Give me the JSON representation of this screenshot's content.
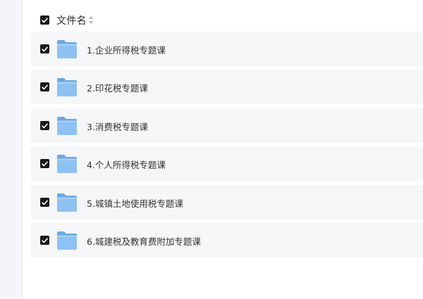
{
  "header": {
    "label": "文件名",
    "select_all_checked": true
  },
  "icons": {
    "checkbox": "checkbox-checked-icon",
    "sort": "sort-icon",
    "folder": "folder-icon"
  },
  "colors": {
    "checkbox": "#1a1a1a",
    "row_background": "#f5f6f8",
    "folder": "#8ec1f2",
    "sidebar": "#f3f5fb"
  },
  "files": [
    {
      "name": "1.企业所得税专题课",
      "checked": true
    },
    {
      "name": "2.印花税专题课",
      "checked": true
    },
    {
      "name": "3.消费税专题课",
      "checked": true
    },
    {
      "name": "4.个人所得税专题课",
      "checked": true
    },
    {
      "name": "5.城镇土地使用税专题课",
      "checked": true
    },
    {
      "name": "6.城建税及教育费附加专题课",
      "checked": true
    }
  ]
}
